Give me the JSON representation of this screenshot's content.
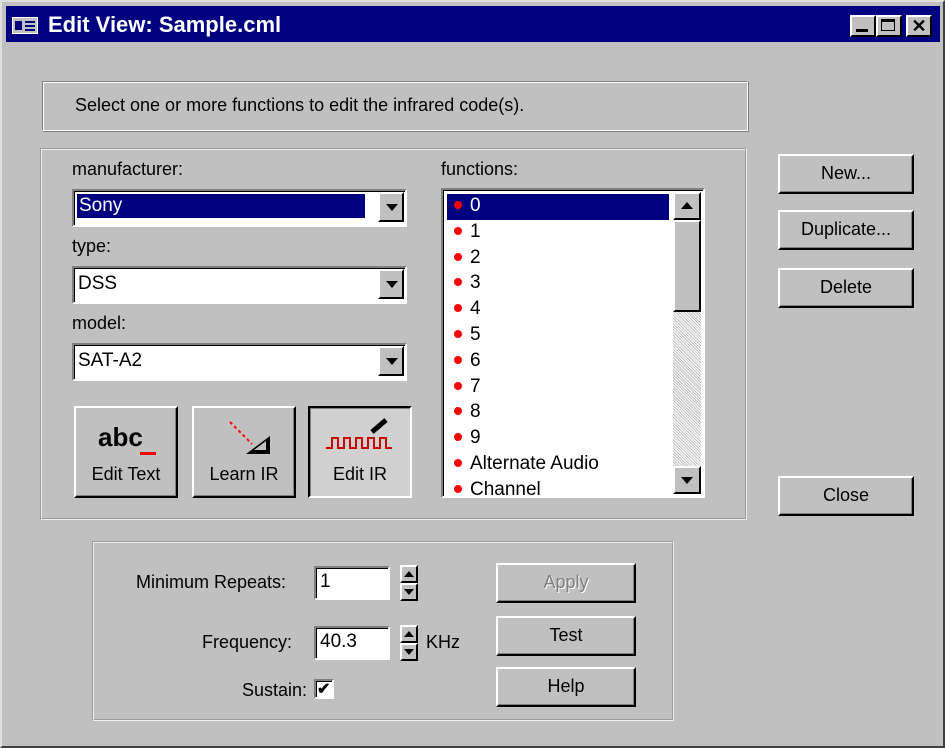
{
  "window": {
    "title": "Edit View: Sample.cml",
    "minimize_icon": "minimize-icon",
    "maximize_icon": "maximize-icon",
    "close_icon": "close-icon"
  },
  "instructions": "Select one or more functions to edit the infrared code(s).",
  "device": {
    "manufacturer_label": "manufacturer:",
    "manufacturer_value": "Sony",
    "type_label": "type:",
    "type_value": "DSS",
    "model_label": "model:",
    "model_value": "SAT-A2"
  },
  "tools": {
    "edit_text_label": "Edit Text",
    "edit_text_icon_text": "abc",
    "learn_ir_label": "Learn IR",
    "edit_ir_label": "Edit IR"
  },
  "functions": {
    "label": "functions:",
    "items": [
      "0",
      "1",
      "2",
      "3",
      "4",
      "5",
      "6",
      "7",
      "8",
      "9",
      "Alternate Audio",
      "Channel"
    ],
    "selected": "0",
    "dot_color": "#ff0000"
  },
  "side_buttons": {
    "new": "New...",
    "duplicate": "Duplicate...",
    "delete": "Delete",
    "close": "Close"
  },
  "settings": {
    "min_repeats_label": "Minimum Repeats:",
    "min_repeats_value": "1",
    "frequency_label": "Frequency:",
    "frequency_value": "40.3",
    "frequency_unit": "KHz",
    "sustain_label": "Sustain:",
    "sustain_checked": true
  },
  "action_buttons": {
    "apply": "Apply",
    "test": "Test",
    "help": "Help"
  },
  "colors": {
    "titlebar": "#000080",
    "face": "#c0c0c0",
    "selection": "#000080"
  }
}
